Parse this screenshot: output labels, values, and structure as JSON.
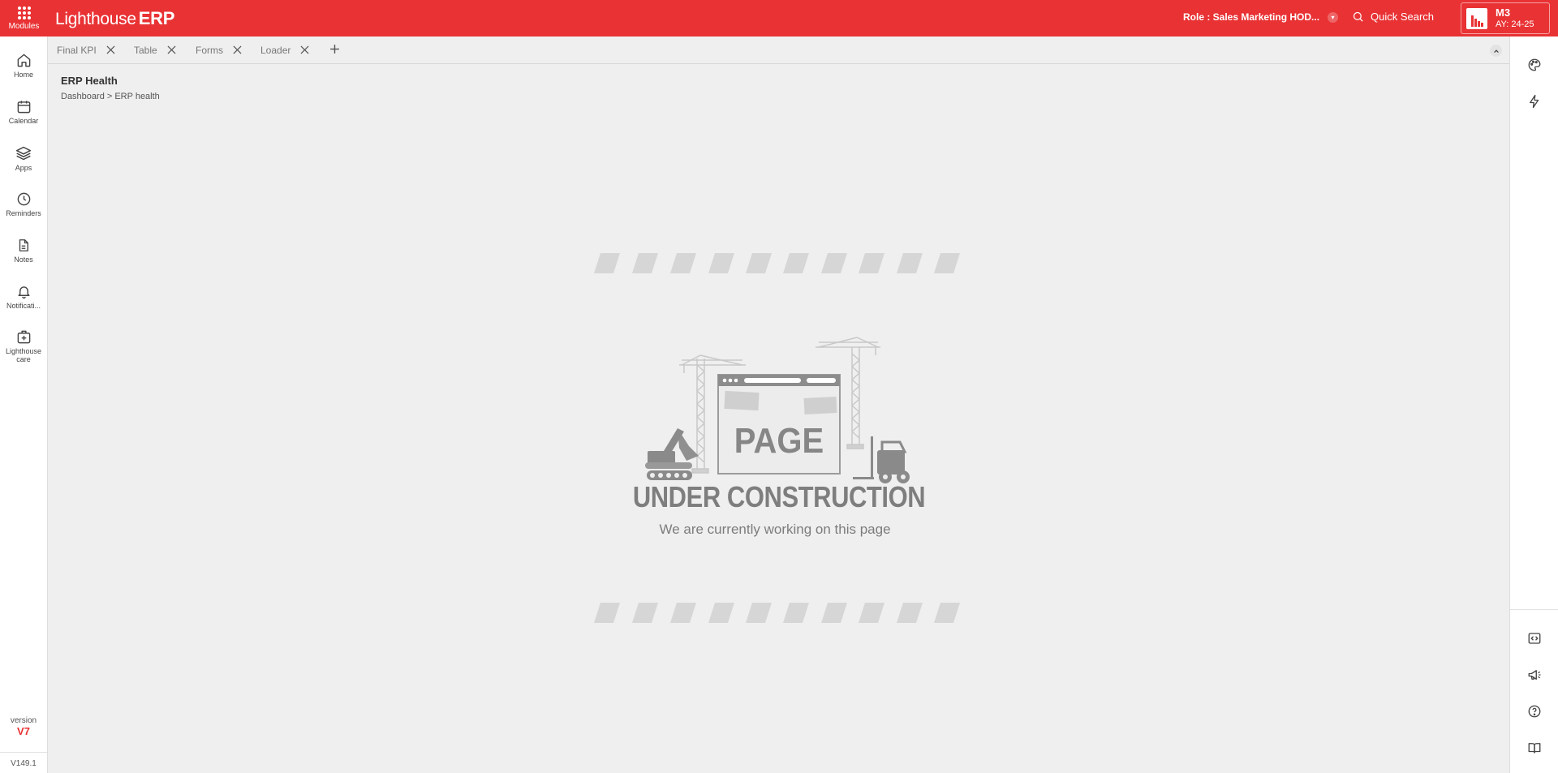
{
  "topbar": {
    "modules_label": "Modules",
    "logo_text": "Lighthouse",
    "logo_erp": "ERP",
    "role_label": "Role : Sales Marketing HOD...",
    "search_label": "Quick Search",
    "company_code": "M3",
    "academic_year": "AY: 24-25",
    "brand_color": "#e93234"
  },
  "sidebar": {
    "items": [
      {
        "label": "Home",
        "icon": "home-icon"
      },
      {
        "label": "Calendar",
        "icon": "calendar-icon"
      },
      {
        "label": "Apps",
        "icon": "layers-icon"
      },
      {
        "label": "Reminders",
        "icon": "clock-icon"
      },
      {
        "label": "Notes",
        "icon": "file-icon"
      },
      {
        "label": "Notificati...",
        "icon": "bell-icon"
      },
      {
        "label": "Lighthouse care",
        "icon": "medical-plus-icon"
      }
    ],
    "version_label": "version",
    "version_value": "V7",
    "build": "V149.1"
  },
  "tabs": [
    {
      "label": "Final KPI"
    },
    {
      "label": "Table"
    },
    {
      "label": "Forms"
    },
    {
      "label": "Loader"
    }
  ],
  "content": {
    "title": "ERP Health",
    "breadcrumb": "Dashboard > ERP health",
    "illustration_word": "PAGE",
    "heading": "UNDER CONSTRUCTION",
    "subheading": "We are currently working on this page"
  },
  "rightrail": {
    "icons": [
      "palette-icon",
      "lightning-icon",
      "code-icon",
      "megaphone-icon",
      "help-icon",
      "book-icon"
    ]
  }
}
